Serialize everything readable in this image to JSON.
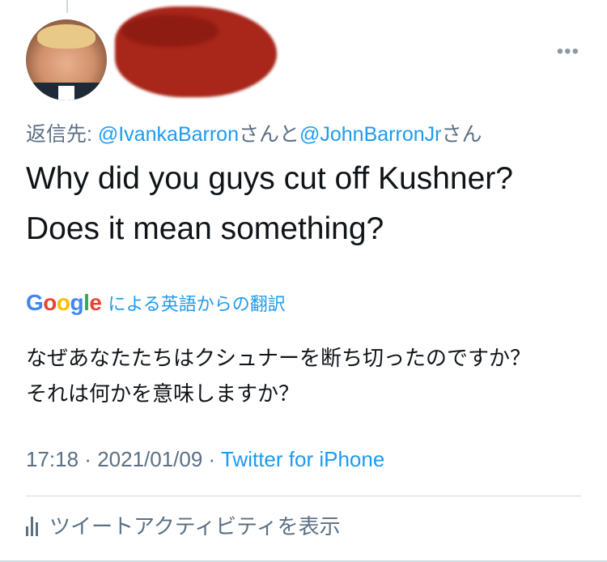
{
  "tweet": {
    "reply_prefix": "返信先: ",
    "reply_mention_1": "@IvankaBarron",
    "reply_join": "さんと",
    "reply_mention_2": "@JohnBarronJr",
    "reply_suffix": "さん",
    "text_line_1": "Why did you guys cut off Kushner?",
    "text_line_2": "Does it mean something?",
    "more_icon": "more-horizontal-icon",
    "google_letters": [
      "G",
      "o",
      "o",
      "g",
      "l",
      "e"
    ],
    "translated_by": "による英語からの翻訳",
    "translation_line_1": "なぜあなたたちはクシュナーを断ち切ったのですか？",
    "translation_line_2": "それは何かを意味しますか？",
    "time": "17:18",
    "separator": " · ",
    "date": "2021/01/09",
    "source": "Twitter for iPhone",
    "activity_label": "ツイートアクティビティを表示",
    "activity_icon": "analytics-bars-icon"
  },
  "colors": {
    "link": "#1d9bf0",
    "secondary_text": "#5b7083",
    "redaction": "#a8261a"
  }
}
